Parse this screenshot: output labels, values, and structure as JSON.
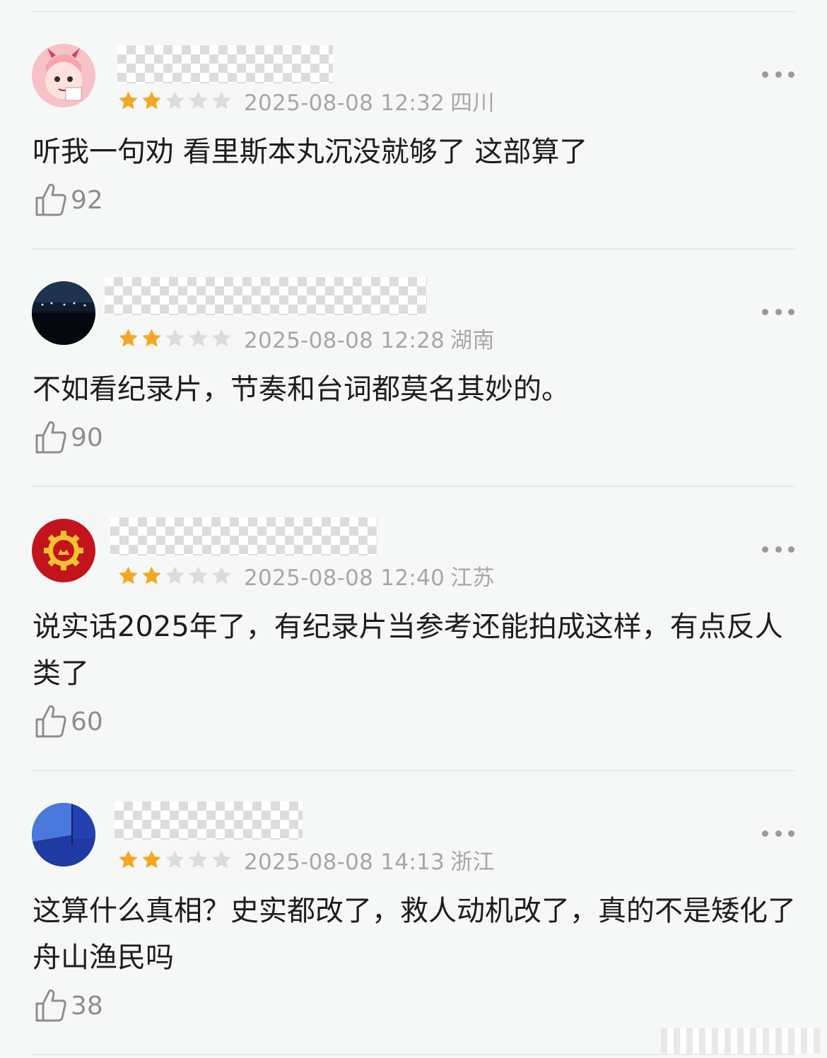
{
  "comments": [
    {
      "rating": 2,
      "max_rating": 5,
      "date": "2025-08-08 12:32",
      "location": "四川",
      "text": "听我一句劝 看里斯本丸沉没就够了 这部算了",
      "likes": "92"
    },
    {
      "rating": 2,
      "max_rating": 5,
      "date": "2025-08-08 12:28",
      "location": "湖南",
      "text": "不如看纪录片，节奏和台词都莫名其妙的。",
      "likes": "90"
    },
    {
      "rating": 2,
      "max_rating": 5,
      "date": "2025-08-08 12:40",
      "location": "江苏",
      "text": "说实话2025年了，有纪录片当参考还能拍成这样，有点反人类了",
      "likes": "60"
    },
    {
      "rating": 2,
      "max_rating": 5,
      "date": "2025-08-08 14:13",
      "location": "浙江",
      "text": "这算什么真相？史实都改了，救人动机改了，真的不是矮化了舟山渔民吗",
      "likes": "38"
    }
  ],
  "colors": {
    "star_filled": "#f5a623",
    "star_empty": "#dcdcdc",
    "meta_text": "#a7a7a7",
    "like_text": "#8e8e8e",
    "background": "#f6f8f7"
  },
  "icons": {
    "more": "more-dots-icon",
    "like": "thumbs-up-icon",
    "star": "star-icon"
  }
}
